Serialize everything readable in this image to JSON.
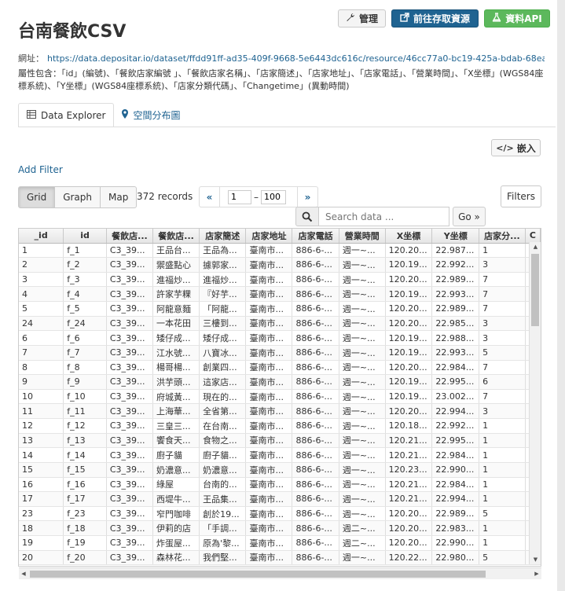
{
  "title": "台南餐飲CSV",
  "buttons": {
    "manage": "管理",
    "resource": "前往存取資源",
    "api": "資料API"
  },
  "url_label": "網址：",
  "url": "https://data.depositar.io/dataset/ffdd91ff-ad35-409f-9668-5e6443dc616c/resource/46cc77a0-bc19-425a-bdab-68ea...",
  "attributes": "屬性包含：「id」(編號)、「餐飲店家編號 」、「餐飲店家名稱」、「店家簡述」、「店家地址」、「店家電話」、「營業時間」、「X坐標」(WGS84座標系統)、「Y坐標」(WGS84座標系統)、「店家分類代碼」、「Changetime」(異動時間)",
  "tabs": [
    {
      "label": "Data Explorer"
    },
    {
      "label": "空間分布圖"
    }
  ],
  "embed_label": "嵌入",
  "add_filter": "Add Filter",
  "views": [
    "Grid",
    "Graph",
    "Map"
  ],
  "records": "372 records",
  "pager": {
    "prev": "«",
    "from": "1",
    "dash": "–",
    "to": "100",
    "next": "»"
  },
  "filters_label": "Filters",
  "search": {
    "placeholder": "Search data ...",
    "go": "Go »"
  },
  "columns": [
    "_id",
    "id",
    "餐飲店...",
    "餐飲店...",
    "店家簡述",
    "店家地址",
    "店家電話",
    "營業時間",
    "X坐標",
    "Y坐標",
    "店家分...",
    "C"
  ],
  "rows": [
    [
      "1",
      "f_1",
      "C3_39...",
      "王品台...",
      "王品為...",
      "臺南市...",
      "886-6-...",
      "週一~...",
      "120.20...",
      "22.987...",
      "1",
      ""
    ],
    [
      "2",
      "f_2",
      "C3_39...",
      "禦盛點心",
      "據郭家...",
      "臺南市...",
      "886-6-...",
      "週一~...",
      "120.19...",
      "22.992...",
      "3",
      ""
    ],
    [
      "3",
      "f_3",
      "C3_39...",
      "進福炒...",
      "進福炒...",
      "臺南市...",
      "886-6-...",
      "週一~...",
      "120.20...",
      "22.989...",
      "7",
      ""
    ],
    [
      "4",
      "f_4",
      "C3_39...",
      "許家芋粿",
      "『好芋...",
      "臺南市...",
      "886-6-...",
      "週一~...",
      "120.19...",
      "22.993...",
      "7",
      ""
    ],
    [
      "5",
      "f_5",
      "C3_39...",
      "阿龍意麵",
      "「阿龍...",
      "臺南市...",
      "886-6-...",
      "週一~...",
      "120.20...",
      "22.989...",
      "7",
      ""
    ],
    [
      "24",
      "f_24",
      "C3_39...",
      "一本花田",
      "三樓到...",
      "臺南市...",
      "886-6-...",
      "週一~...",
      "120.20...",
      "22.985...",
      "3",
      ""
    ],
    [
      "6",
      "f_6",
      "C3_39...",
      "矮仔成...",
      "矮仔成...",
      "臺南市...",
      "886-6-...",
      "週一~...",
      "120.19...",
      "22.988...",
      "3",
      ""
    ],
    [
      "7",
      "f_7",
      "C3_39...",
      "江水號...",
      "八寶冰...",
      "臺南市...",
      "886-6-...",
      "週一~...",
      "120.19...",
      "22.993...",
      "5",
      ""
    ],
    [
      "8",
      "f_8",
      "C3_39...",
      "楊哥楊...",
      "創業四...",
      "臺南市...",
      "886-6-...",
      "週一~...",
      "120.20...",
      "22.984...",
      "7",
      ""
    ],
    [
      "9",
      "f_9",
      "C3_39...",
      "洪芋頭...",
      "這家店...",
      "臺南市...",
      "886-6-...",
      "週一~...",
      "120.19...",
      "22.995...",
      "6",
      ""
    ],
    [
      "10",
      "f_10",
      "C3_39...",
      "府城黃...",
      "現在的...",
      "臺南市...",
      "886-6-...",
      "週一~...",
      "120.19...",
      "23.002...",
      "7",
      ""
    ],
    [
      "11",
      "f_11",
      "C3_39...",
      "上海華...",
      "全省第...",
      "臺南市...",
      "886-6-...",
      "週一~...",
      "120.20...",
      "22.994...",
      "3",
      ""
    ],
    [
      "12",
      "f_12",
      "C3_39...",
      "三皇三...",
      "在台南...",
      "臺南市...",
      "886-6-...",
      "週一~...",
      "120.18...",
      "22.992...",
      "1",
      ""
    ],
    [
      "13",
      "f_13",
      "C3_39...",
      "饗食天...",
      "食物之...",
      "臺南市...",
      "886-6-...",
      "週一~...",
      "120.21...",
      "22.995...",
      "1",
      ""
    ],
    [
      "14",
      "f_14",
      "C3_39...",
      "廚子貓",
      "廚子貓...",
      "臺南市...",
      "886-6-...",
      "週一~...",
      "120.21...",
      "22.984...",
      "1",
      ""
    ],
    [
      "15",
      "f_15",
      "C3_39...",
      "奶濃意...",
      "奶濃意...",
      "臺南市...",
      "886-6-...",
      "週一~...",
      "120.23...",
      "22.990...",
      "1",
      ""
    ],
    [
      "16",
      "f_16",
      "C3_39...",
      "綠屋",
      "台南的...",
      "臺南市...",
      "886-6-...",
      "週一~...",
      "120.21...",
      "22.984...",
      "1",
      ""
    ],
    [
      "17",
      "f_17",
      "C3_39...",
      "西堤牛...",
      "王品集...",
      "臺南市...",
      "886-6-...",
      "週一~...",
      "120.21...",
      "22.994...",
      "1",
      ""
    ],
    [
      "23",
      "f_23",
      "C3_39...",
      "窄門咖啡",
      "創於19...",
      "臺南市...",
      "886-6-...",
      "週一~...",
      "120.20...",
      "22.989...",
      "5",
      ""
    ],
    [
      "18",
      "f_18",
      "C3_39...",
      "伊莉的店",
      "「手調...",
      "臺南市...",
      "886-6-...",
      "週二~...",
      "120.20...",
      "22.983...",
      "1",
      ""
    ],
    [
      "19",
      "f_19",
      "C3_39...",
      "炸蛋屋...",
      "原為'黎...",
      "臺南市...",
      "886-6-...",
      "週二~...",
      "120.20...",
      "22.990...",
      "1",
      ""
    ],
    [
      "20",
      "f_20",
      "C3_39...",
      "森林花...",
      "我們堅...",
      "臺南市...",
      "886-6-...",
      "週一~...",
      "120.22...",
      "22.980...",
      "5",
      ""
    ]
  ]
}
